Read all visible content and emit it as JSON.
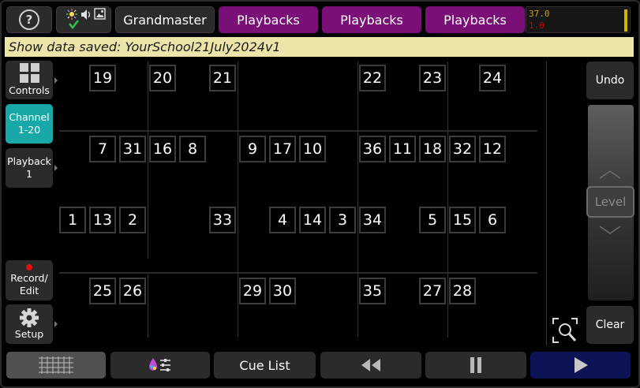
{
  "top_bar": {
    "help_label": "?",
    "grandmaster_label": "Grandmaster",
    "playbacks": [
      "Playbacks",
      "Playbacks",
      "Playbacks"
    ],
    "meter_top": "37.0",
    "meter_bottom": "1.0"
  },
  "banner": {
    "text": "Show data saved: YourSchool21July2024v1"
  },
  "sidebar": {
    "controls": "Controls",
    "channel_line1": "Channel",
    "channel_line2": "1-20",
    "playback_line1": "Playback",
    "playback_line2": "1",
    "record_line1": "Record/",
    "record_line2": "Edit",
    "setup": "Setup"
  },
  "channels": {
    "row1": [
      "19",
      "20",
      "21",
      "22",
      "23",
      "24"
    ],
    "row2": [
      "7",
      "31",
      "16",
      "8",
      "9",
      "17",
      "10",
      "36",
      "11",
      "18",
      "32",
      "12"
    ],
    "row3": [
      "1",
      "13",
      "2",
      "33",
      "4",
      "14",
      "3",
      "34",
      "5",
      "15",
      "6"
    ],
    "row4": [
      "25",
      "26",
      "29",
      "30",
      "35",
      "27",
      "28"
    ]
  },
  "right": {
    "undo": "Undo",
    "level": "Level",
    "clear": "Clear"
  },
  "bottom_bar": {
    "cue_list": "Cue List"
  },
  "colors": {
    "purple": "#7b0f78",
    "active_teal": "#19a8a8",
    "banner_bg": "#ece4a8",
    "play_blue": "#0d1456"
  }
}
